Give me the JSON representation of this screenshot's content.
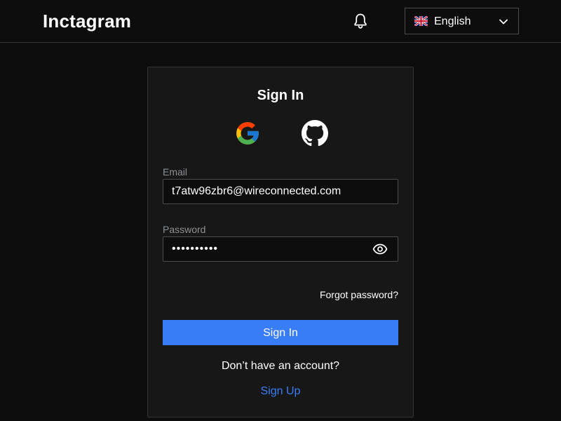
{
  "header": {
    "logo": "Inctagram",
    "notifications_icon": "bell-icon",
    "language": {
      "flag_icon": "uk-flag-icon",
      "selected": "English",
      "chevron_icon": "chevron-down-icon"
    }
  },
  "signin": {
    "title": "Sign In",
    "oauth": {
      "google_icon": "google-icon",
      "github_icon": "github-icon"
    },
    "email": {
      "label": "Email",
      "value": "t7atw96zbr6@wireconnected.com"
    },
    "password": {
      "label": "Password",
      "value": "••••••••••",
      "toggle_icon": "eye-icon"
    },
    "forgot_password": "Forgot password?",
    "submit_label": "Sign In",
    "no_account_text": "Don’t have an account?",
    "signup_label": "Sign Up"
  },
  "colors": {
    "background": "#0d0d0d",
    "card": "#171717",
    "border": "#333333",
    "accent": "#397df6",
    "muted_text": "#8d9094"
  }
}
